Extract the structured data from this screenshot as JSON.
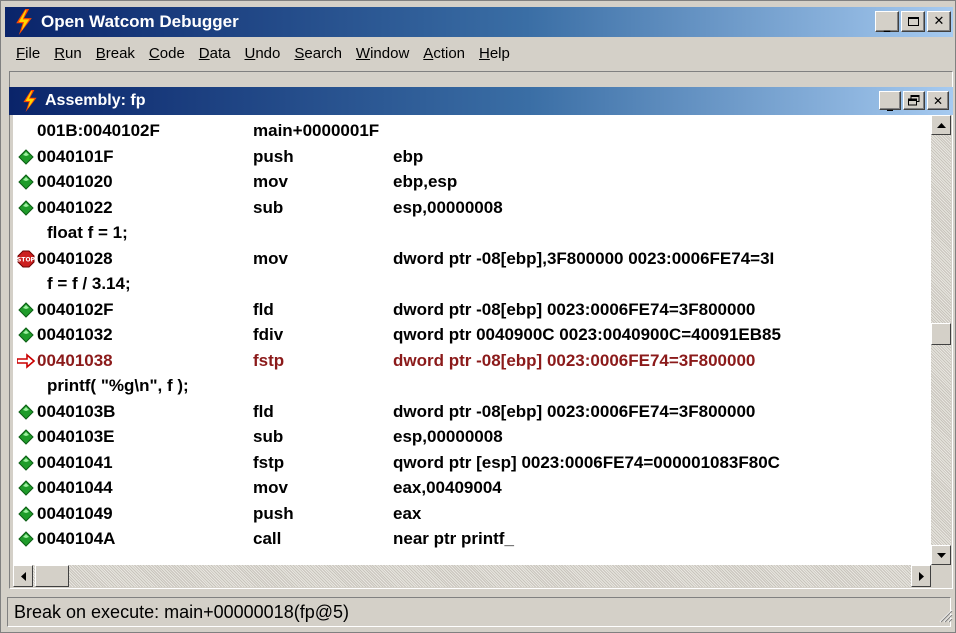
{
  "app": {
    "title": "Open Watcom Debugger"
  },
  "window_buttons": {
    "minimize": "_",
    "restore": "□",
    "maximize": "🗗",
    "close": "✕"
  },
  "menu": [
    {
      "label": "File",
      "ul": "F",
      "rest": "ile"
    },
    {
      "label": "Run",
      "ul": "R",
      "rest": "un"
    },
    {
      "label": "Break",
      "ul": "B",
      "rest": "reak"
    },
    {
      "label": "Code",
      "ul": "C",
      "rest": "ode"
    },
    {
      "label": "Data",
      "ul": "D",
      "rest": "ata"
    },
    {
      "label": "Undo",
      "ul": "U",
      "rest": "ndo"
    },
    {
      "label": "Search",
      "ul": "S",
      "rest": "earch"
    },
    {
      "label": "Window",
      "ul": "W",
      "rest": "indow"
    },
    {
      "label": "Action",
      "ul": "A",
      "rest": "ction"
    },
    {
      "label": "Help",
      "ul": "H",
      "rest": "elp"
    }
  ],
  "assembly": {
    "title": "Assembly: fp",
    "lines": [
      {
        "kind": "header",
        "marker": "none",
        "addr": "001B:0040102F",
        "op": "main+0000001F",
        "arg": ""
      },
      {
        "kind": "asm",
        "marker": "diamond",
        "addr": "0040101F",
        "op": "push",
        "arg": "ebp"
      },
      {
        "kind": "asm",
        "marker": "diamond",
        "addr": "00401020",
        "op": "mov",
        "arg": "ebp,esp"
      },
      {
        "kind": "asm",
        "marker": "diamond",
        "addr": "00401022",
        "op": "sub",
        "arg": "esp,00000008"
      },
      {
        "kind": "src",
        "marker": "none",
        "text": "float f = 1;"
      },
      {
        "kind": "asm",
        "marker": "stop",
        "addr": "00401028",
        "op": "mov",
        "arg": "dword ptr -08[ebp],3F800000    0023:0006FE74=3I"
      },
      {
        "kind": "src",
        "marker": "none",
        "text": "f = f / 3.14;"
      },
      {
        "kind": "asm",
        "marker": "diamond",
        "addr": "0040102F",
        "op": "fld",
        "arg": "dword ptr -08[ebp]      0023:0006FE74=3F800000"
      },
      {
        "kind": "asm",
        "marker": "diamond",
        "addr": "00401032",
        "op": "fdiv",
        "arg": "qword ptr 0040900C    0023:0040900C=40091EB85"
      },
      {
        "kind": "asm",
        "marker": "arrow",
        "addr": "00401038",
        "op": "fstp",
        "arg": "dword ptr -08[ebp]      0023:0006FE74=3F800000"
      },
      {
        "kind": "src",
        "marker": "none",
        "text": "printf( \"%g\\n\", f );"
      },
      {
        "kind": "asm",
        "marker": "diamond",
        "addr": "0040103B",
        "op": "fld",
        "arg": "dword ptr -08[ebp]      0023:0006FE74=3F800000"
      },
      {
        "kind": "asm",
        "marker": "diamond",
        "addr": "0040103E",
        "op": "sub",
        "arg": "esp,00000008"
      },
      {
        "kind": "asm",
        "marker": "diamond",
        "addr": "00401041",
        "op": "fstp",
        "arg": "qword ptr [esp]    0023:0006FE74=000001083F80C"
      },
      {
        "kind": "asm",
        "marker": "diamond",
        "addr": "00401044",
        "op": "mov",
        "arg": "eax,00409004"
      },
      {
        "kind": "asm",
        "marker": "diamond",
        "addr": "00401049",
        "op": "push",
        "arg": "eax"
      },
      {
        "kind": "asm",
        "marker": "diamond",
        "addr": "0040104A",
        "op": "call",
        "arg": "near ptr printf_"
      }
    ]
  },
  "status": {
    "text": "Break on execute: main+00000018(fp@5)"
  },
  "colors": {
    "title_from": "#0a246a",
    "title_to": "#a6caf0",
    "current_line": "#8b1a1a",
    "marker_green": "#1f9c2a",
    "stop_red": "#cc1f1f"
  }
}
